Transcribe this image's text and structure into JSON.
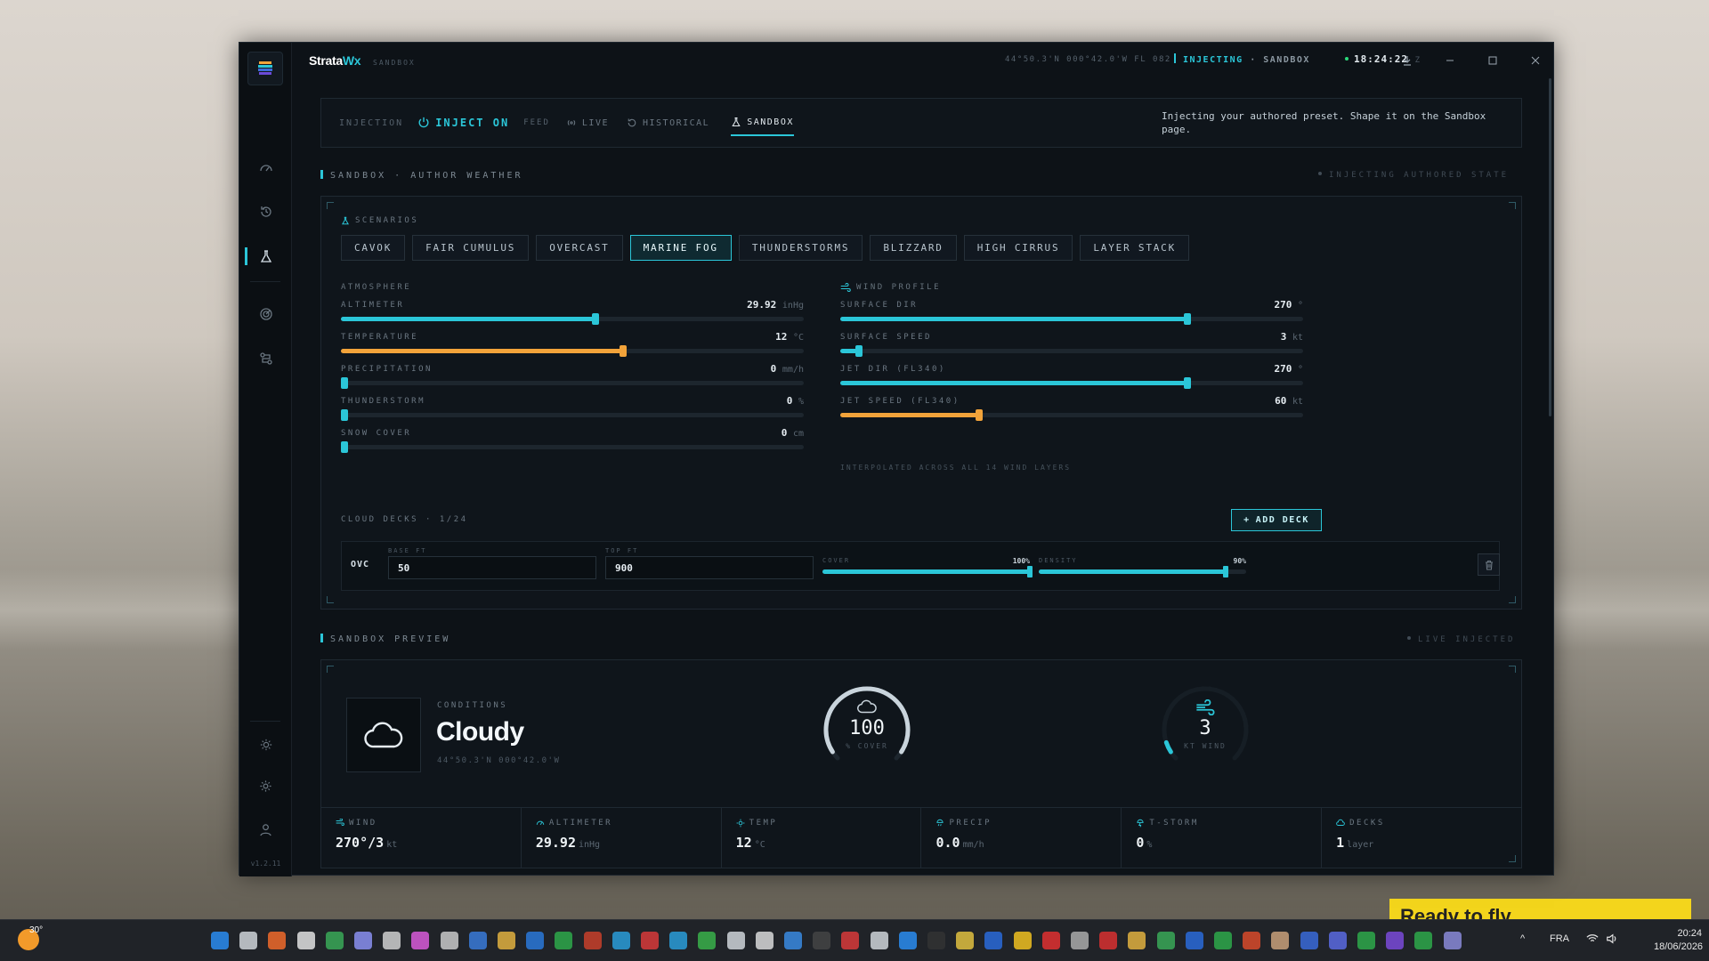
{
  "app": {
    "brand": "Strata",
    "brand_accent": "Wx",
    "sub": "SANDBOX",
    "coords": "44°50.3'N 000°42.0'W  FL 082",
    "inj_label": "INJECTING",
    "inj_mode": "· SANDBOX",
    "clock": "18:24:22",
    "clock_z": "Z",
    "version": "v1.2.11"
  },
  "modebar": {
    "injection": "INJECTION",
    "inject_on": "INJECT ON",
    "feed": "FEED",
    "tabs": [
      "LIVE",
      "HISTORICAL",
      "SANDBOX"
    ],
    "note": "Injecting your authored preset. Shape it on the Sandbox page."
  },
  "author": {
    "heading": "SANDBOX · AUTHOR WEATHER",
    "status": "INJECTING AUTHORED STATE",
    "scenarios_label": "SCENARIOS",
    "scenarios": [
      "CAVOK",
      "FAIR CUMULUS",
      "OVERCAST",
      "MARINE FOG",
      "THUNDERSTORMS",
      "BLIZZARD",
      "HIGH CIRRUS",
      "LAYER STACK"
    ],
    "selected": "MARINE FOG",
    "atmosphere_label": "ATMOSPHERE",
    "wind_label": "WIND PROFILE",
    "atmosphere": [
      {
        "label": "ALTIMETER",
        "value": "29.92",
        "unit": "inHg",
        "fraction": 0.55,
        "color": "cyan"
      },
      {
        "label": "TEMPERATURE",
        "value": "12",
        "unit": "°C",
        "fraction": 0.61,
        "color": "amber"
      },
      {
        "label": "PRECIPITATION",
        "value": "0",
        "unit": "mm/h",
        "fraction": 0.0,
        "color": "cyan"
      },
      {
        "label": "THUNDERSTORM",
        "value": "0",
        "unit": "%",
        "fraction": 0.0,
        "color": "cyan"
      },
      {
        "label": "SNOW COVER",
        "value": "0",
        "unit": "cm",
        "fraction": 0.0,
        "color": "cyan"
      }
    ],
    "wind": [
      {
        "label": "SURFACE DIR",
        "value": "270",
        "unit": "°",
        "fraction": 0.75,
        "color": "cyan"
      },
      {
        "label": "SURFACE SPEED",
        "value": "3",
        "unit": "kt",
        "fraction": 0.04,
        "color": "cyan"
      },
      {
        "label": "JET DIR (FL340)",
        "value": "270",
        "unit": "°",
        "fraction": 0.75,
        "color": "cyan"
      },
      {
        "label": "JET SPEED (FL340)",
        "value": "60",
        "unit": "kt",
        "fraction": 0.3,
        "color": "amber"
      }
    ],
    "interp": "INTERPOLATED ACROSS ALL 14 WIND LAYERS",
    "decks_label": "CLOUD DECKS · 1/24",
    "add_deck": "ADD DECK",
    "deck": {
      "type": "OVC",
      "base_label": "BASE FT",
      "base": "50",
      "top_label": "TOP FT",
      "top": "900",
      "cover_label": "COVER",
      "cover": "100%",
      "cover_frac": 1.0,
      "density_label": "DENSITY",
      "density": "90%",
      "density_frac": 0.9
    }
  },
  "preview": {
    "heading": "SANDBOX PREVIEW",
    "status": "LIVE INJECTED",
    "cond_label": "CONDITIONS",
    "cond": "Cloudy",
    "cond_sub": "44°50.3'N 000°42.0'W",
    "cover_value": "100",
    "cover_sub": "% COVER",
    "cover_frac": 1.0,
    "wind_value": "3",
    "wind_sub": "KT WIND",
    "wind_frac": 0.04,
    "stats": [
      {
        "label": "WIND",
        "value": "270°/3",
        "unit": "kt"
      },
      {
        "label": "ALTIMETER",
        "value": "29.92",
        "unit": "inHg"
      },
      {
        "label": "TEMP",
        "value": "12",
        "unit": "°C"
      },
      {
        "label": "PRECIP",
        "value": "0.0",
        "unit": "mm/h"
      },
      {
        "label": "T-STORM",
        "value": "0",
        "unit": "%"
      },
      {
        "label": "DECKS",
        "value": "1",
        "unit": "layer"
      }
    ]
  },
  "taskbar": {
    "weather_temp": "30°",
    "lang": "FRA",
    "time": "20:24",
    "date": "18/06/2026"
  },
  "banner": "Ready to fly"
}
